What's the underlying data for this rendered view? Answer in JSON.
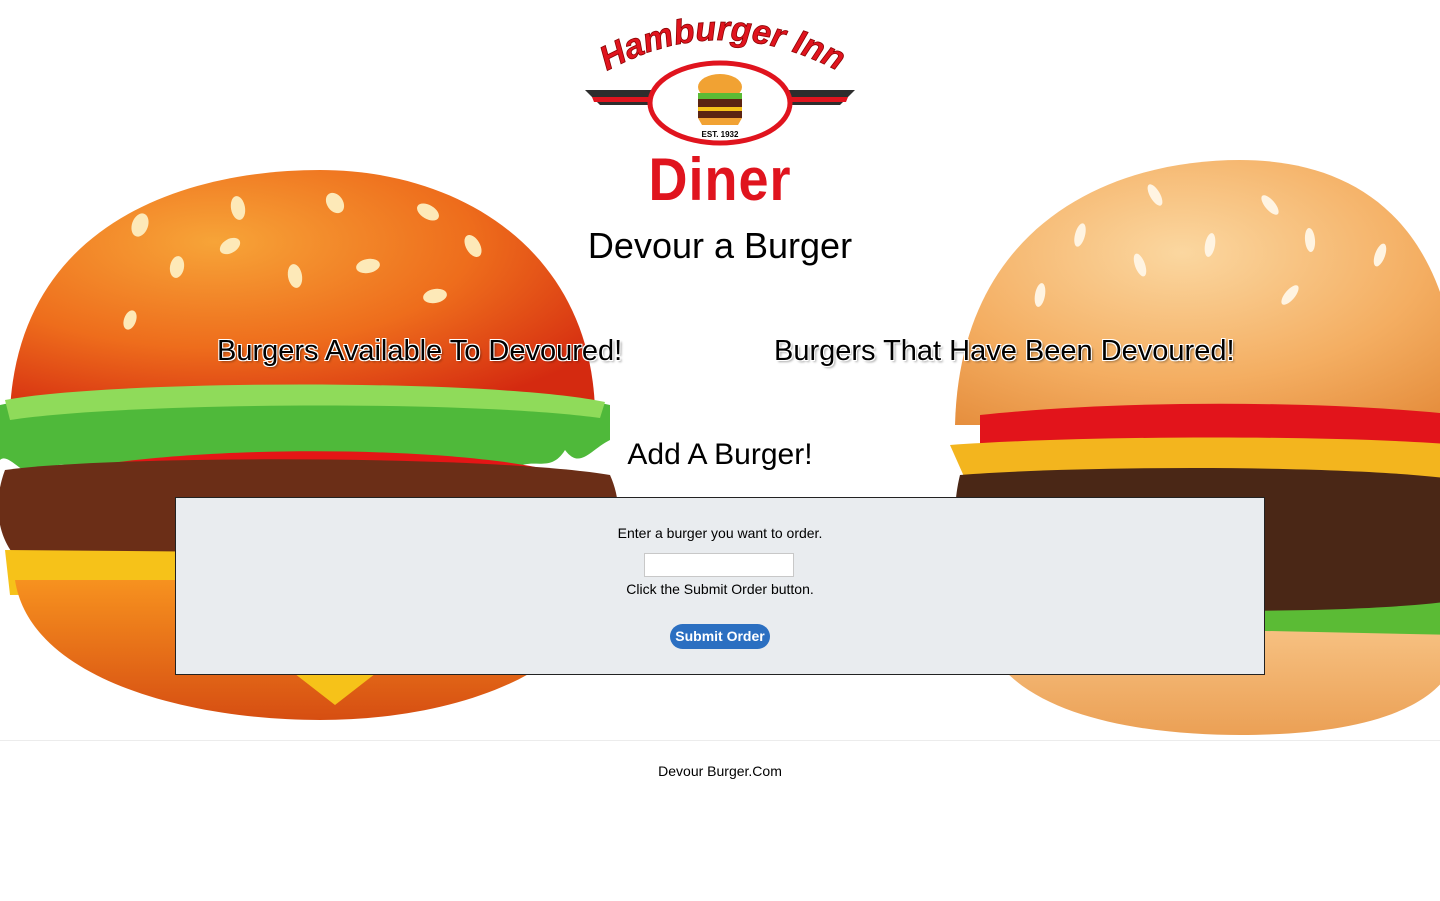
{
  "logo": {
    "top_text": "Hamburger Inn",
    "badge": "EST. 1932",
    "bottom_text": "Diner",
    "colors": {
      "red": "#e0141e",
      "dark": "#2d2d2d"
    }
  },
  "page_title": "Devour a Burger",
  "columns": {
    "available_heading": "Burgers Available To Devoured!",
    "devoured_heading": "Burgers That Have Been Devoured!"
  },
  "add_form": {
    "heading": "Add A Burger!",
    "prompt": "Enter a burger you want to order.",
    "input_value": "",
    "instruction": "Click the Submit Order button.",
    "submit_label": "Submit Order",
    "panel_color": "#e9ecef",
    "button_color": "#2b6fc1"
  },
  "footer": {
    "text": "Devour Burger.Com"
  },
  "background_icons": [
    "burger-emoji-left",
    "burger-emoji-right"
  ]
}
